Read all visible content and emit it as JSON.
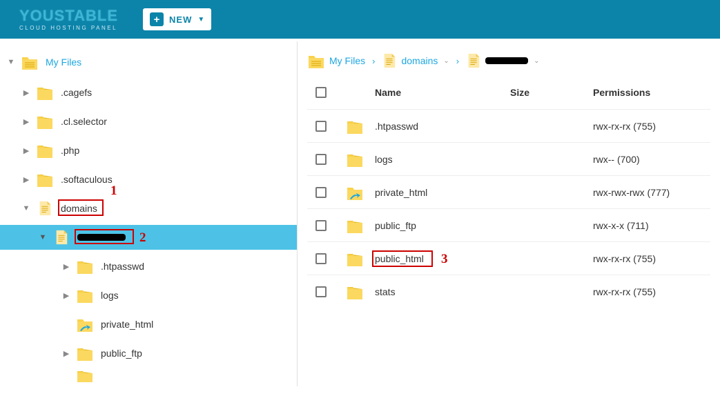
{
  "brand": {
    "name": "YOUSTABLE",
    "tag": "CLOUD HOSTING PANEL"
  },
  "topbar": {
    "new_label": "NEW"
  },
  "tree": {
    "root_label": "My Files",
    "lvl1": [
      {
        "label": ".cagefs",
        "type": "folder"
      },
      {
        "label": ".cl.selector",
        "type": "folder"
      },
      {
        "label": ".php",
        "type": "folder"
      },
      {
        "label": ".softaculous",
        "type": "folder"
      },
      {
        "label": "domains",
        "type": "doc",
        "expanded": true,
        "annot": 1
      }
    ],
    "domain_child": {
      "redacted_width": 70,
      "annot": 2
    },
    "lvl3": [
      {
        "label": ".htpasswd",
        "type": "folder"
      },
      {
        "label": "logs",
        "type": "folder"
      },
      {
        "label": "private_html",
        "type": "shortcut"
      },
      {
        "label": "public_ftp",
        "type": "folder"
      }
    ]
  },
  "breadcrumb": {
    "items": [
      {
        "label": "My Files",
        "type": "folder",
        "caret": false
      },
      {
        "label": "domains",
        "type": "doc",
        "caret": true
      },
      {
        "label": "",
        "type": "doc",
        "caret": true,
        "redacted_width": 62
      }
    ]
  },
  "table": {
    "headers": {
      "name": "Name",
      "size": "Size",
      "perm": "Permissions"
    },
    "rows": [
      {
        "name": ".htpasswd",
        "type": "folder",
        "size": "",
        "perm": "rwx-rx-rx (755)"
      },
      {
        "name": "logs",
        "type": "folder",
        "size": "",
        "perm": "rwx-- (700)"
      },
      {
        "name": "private_html",
        "type": "shortcut",
        "size": "",
        "perm": "rwx-rwx-rwx (777)"
      },
      {
        "name": "public_ftp",
        "type": "folder",
        "size": "",
        "perm": "rwx-x-x (711)"
      },
      {
        "name": "public_html",
        "type": "folder",
        "size": "",
        "perm": "rwx-rx-rx (755)",
        "annot": 3
      },
      {
        "name": "stats",
        "type": "folder",
        "size": "",
        "perm": "rwx-rx-rx (755)"
      }
    ]
  }
}
